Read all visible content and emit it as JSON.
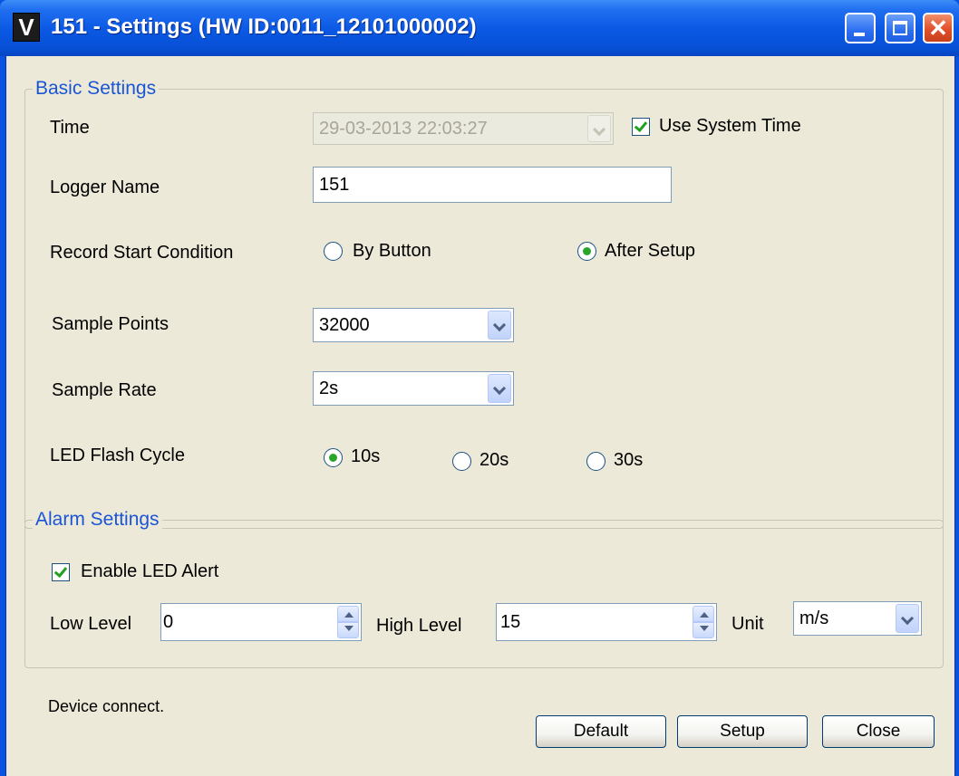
{
  "window": {
    "title": "151 - Settings (HW ID:0011_12101000002)",
    "icon_glyph": "V"
  },
  "basic": {
    "legend": "Basic Settings",
    "time_label": "Time",
    "time_value": "29-03-2013 22:03:27",
    "use_system_time_label": "Use System Time",
    "use_system_time_checked": true,
    "logger_name_label": "Logger Name",
    "logger_name_value": "151",
    "record_start_label": "Record Start Condition",
    "record_start_options": [
      "By Button",
      "After Setup"
    ],
    "record_start_selected": "After Setup",
    "sample_points_label": "Sample Points",
    "sample_points_value": "32000",
    "sample_rate_label": "Sample Rate",
    "sample_rate_value": "2s",
    "led_flash_label": "LED Flash Cycle",
    "led_flash_options": [
      "10s",
      "20s",
      "30s"
    ],
    "led_flash_selected": "10s"
  },
  "alarm": {
    "legend": "Alarm Settings",
    "enable_led_label": "Enable LED Alert",
    "enable_led_checked": true,
    "low_level_label": "Low Level",
    "low_level_value": "0",
    "high_level_label": "High Level",
    "high_level_value": "15",
    "unit_label": "Unit",
    "unit_value": "m/s"
  },
  "status_text": "Device connect.",
  "buttons": {
    "default": "Default",
    "setup": "Setup",
    "close": "Close"
  }
}
